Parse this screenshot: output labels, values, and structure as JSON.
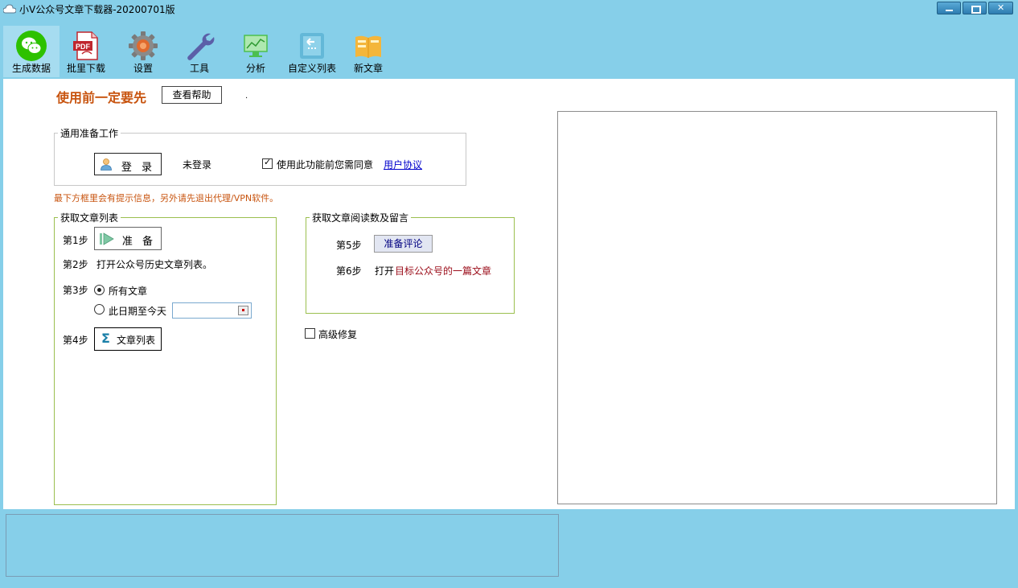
{
  "window": {
    "title": "小V公众号文章下载器-20200701版"
  },
  "toolbar": {
    "items": [
      {
        "label": "生成数据",
        "icon": "wechat-icon"
      },
      {
        "label": "批里下载",
        "icon": "pdf-icon"
      },
      {
        "label": "设置",
        "icon": "gear-icon"
      },
      {
        "label": "工具",
        "icon": "wrench-icon"
      },
      {
        "label": "分析",
        "icon": "chart-icon"
      },
      {
        "label": "自定义列表",
        "icon": "custom-list-icon"
      },
      {
        "label": "新文章",
        "icon": "new-article-icon"
      }
    ],
    "active_index": 0
  },
  "header": {
    "warning": "使用前一定要先",
    "help_button": "查看帮助",
    "dot": "."
  },
  "prep_group": {
    "legend": "通用准备工作",
    "login_button": "登 录",
    "login_status": "未登录",
    "agree_text": "使用此功能前您需同意",
    "agree_checked": true,
    "agreement_link": "用户协议"
  },
  "notice": "最下方框里会有提示信息，另外请先退出代理/VPN软件。",
  "list_group": {
    "legend": "获取文章列表",
    "step1_label": "第1步",
    "step1_button": "准 备",
    "step2_label": "第2步",
    "step2_text": "打开公众号历史文章列表。",
    "step3_label": "第3步",
    "radio_all": "所有文章",
    "radio_date": "此日期至今天",
    "date_value": "",
    "step4_label": "第4步",
    "step4_button": "文章列表"
  },
  "read_group": {
    "legend": "获取文章阅读数及留言",
    "step5_label": "第5步",
    "step5_button": "准备评论",
    "step6_label": "第6步",
    "step6_open": "打开",
    "step6_target": "目标公众号的一篇文章"
  },
  "advanced": {
    "label": "高级修复",
    "checked": false
  },
  "colors": {
    "window_bg": "#86cfe9",
    "accent_orange": "#c8540f",
    "group_border_green": "#9bbf4f",
    "link_blue": "#0000cc",
    "target_red": "#9a0b18"
  }
}
